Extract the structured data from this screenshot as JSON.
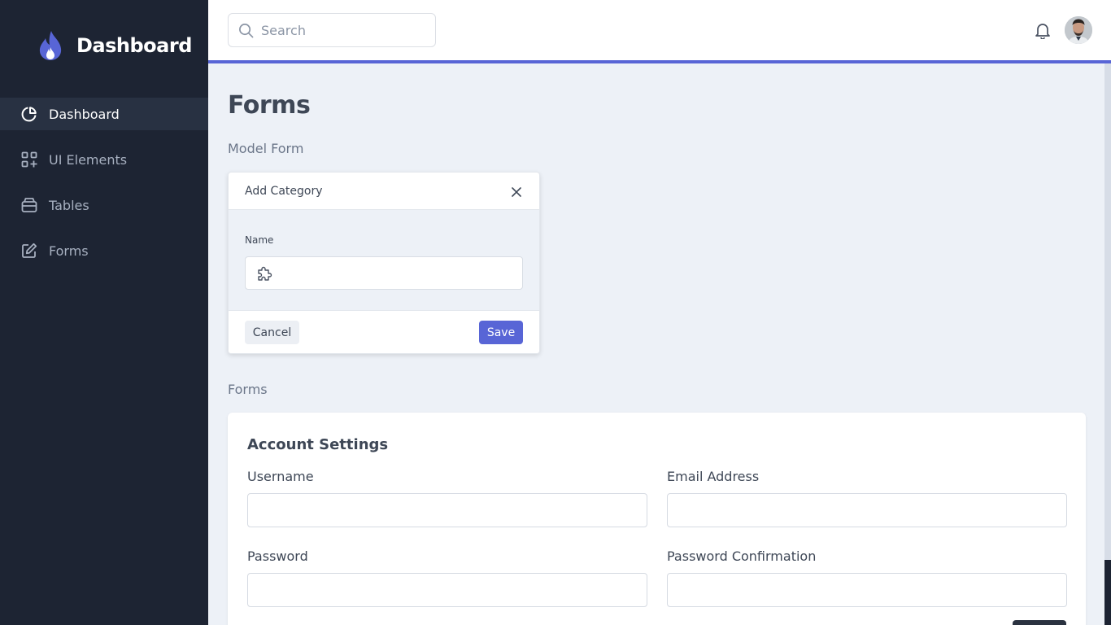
{
  "brand": {
    "title": "Dashboard"
  },
  "sidebar": {
    "items": [
      {
        "label": "Dashboard",
        "icon": "pie-chart-icon",
        "active": true
      },
      {
        "label": "UI Elements",
        "icon": "grid-plus-icon",
        "active": false
      },
      {
        "label": "Tables",
        "icon": "archive-icon",
        "active": false
      },
      {
        "label": "Forms",
        "icon": "edit-icon",
        "active": false
      }
    ]
  },
  "header": {
    "search_placeholder": "Search",
    "bell_icon": "bell-icon",
    "avatar_icon": "user-avatar"
  },
  "main": {
    "title": "Forms",
    "model_form_label": "Model Form",
    "forms_label": "Forms"
  },
  "modal": {
    "title": "Add Category",
    "name_label": "Name",
    "name_value": "",
    "cancel_label": "Cancel",
    "save_label": "Save"
  },
  "account": {
    "title": "Account Settings",
    "username_label": "Username",
    "email_label": "Email Address",
    "password_label": "Password",
    "password_confirm_label": "Password Confirmation",
    "username_value": "",
    "email_value": "",
    "password_value": "",
    "password_confirm_value": ""
  },
  "colors": {
    "sidebar_bg": "#1d2433",
    "accent": "#5865d6",
    "page_bg": "#edf1f7"
  }
}
